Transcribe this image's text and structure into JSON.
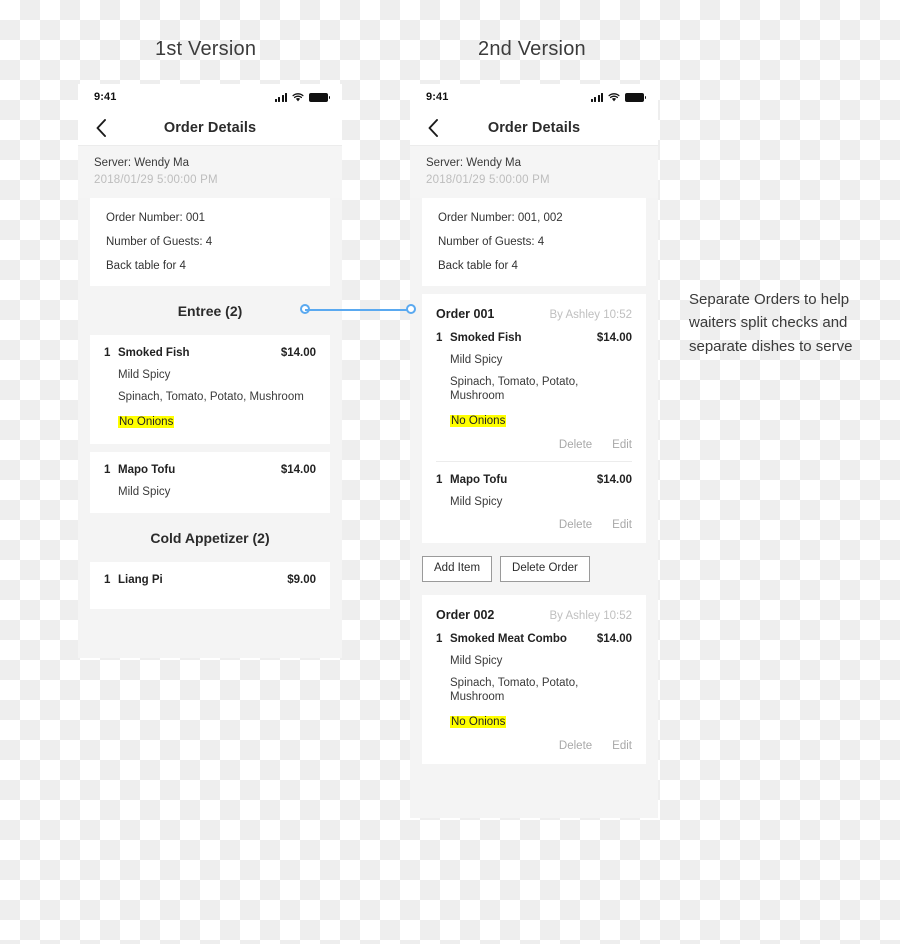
{
  "captions": {
    "version1": "1st Version",
    "version2": "2nd Version"
  },
  "annotation": {
    "text": "Separate Orders to help waiters split checks and separate dishes to serve"
  },
  "colors": {
    "accent": "#5aa9f0",
    "highlight": "#ffff00",
    "page_bg": "#f4f4f4",
    "card_bg": "#ffffff",
    "muted_text": "#bdbdbd"
  },
  "phone1": {
    "status": {
      "time": "9:41",
      "signal_icon": "signal-bars-icon",
      "wifi_icon": "wifi-icon",
      "battery_icon": "battery-full-icon"
    },
    "nav": {
      "back_icon": "chevron-left-icon",
      "title": "Order Details"
    },
    "server": {
      "name": "Server: Wendy Ma",
      "datetime": "2018/01/29  5:00:00 PM"
    },
    "info": {
      "order_number": "Order Number: 001",
      "guests": "Number of Guests: 4",
      "table": "Back table for 4"
    },
    "sections": [
      {
        "header": "Entree (2)",
        "items": [
          {
            "qty": "1",
            "name": "Smoked Fish",
            "price": "$14.00",
            "options": [
              "Mild Spicy",
              "Spinach, Tomato, Potato, Mushroom"
            ],
            "note": "No Onions"
          },
          {
            "qty": "1",
            "name": "Mapo Tofu",
            "price": "$14.00",
            "options": [
              "Mild Spicy"
            ],
            "note": ""
          }
        ]
      },
      {
        "header": "Cold Appetizer (2)",
        "items": [
          {
            "qty": "1",
            "name": "Liang Pi",
            "price": "$9.00",
            "options": [],
            "note": ""
          }
        ]
      }
    ]
  },
  "phone2": {
    "status": {
      "time": "9:41",
      "signal_icon": "signal-bars-icon",
      "wifi_icon": "wifi-icon",
      "battery_icon": "battery-full-icon"
    },
    "nav": {
      "back_icon": "chevron-left-icon",
      "title": "Order Details"
    },
    "server": {
      "name": "Server: Wendy Ma",
      "datetime": "2018/01/29  5:00:00 PM"
    },
    "info": {
      "order_number": "Order Number: 001, 002",
      "guests": "Number of Guests: 4",
      "table": "Back table for 4"
    },
    "orders": [
      {
        "title": "Order 001",
        "by": "By Ashley 10:52",
        "items": [
          {
            "qty": "1",
            "name": "Smoked Fish",
            "price": "$14.00",
            "options": [
              "Mild Spicy",
              "Spinach, Tomato, Potato, Mushroom"
            ],
            "note": "No Onions",
            "delete_label": "Delete",
            "edit_label": "Edit"
          },
          {
            "qty": "1",
            "name": "Mapo Tofu",
            "price": "$14.00",
            "options": [
              "Mild Spicy"
            ],
            "note": "",
            "delete_label": "Delete",
            "edit_label": "Edit"
          }
        ],
        "buttons": {
          "add_item": "Add Item",
          "delete_order": "Delete Order"
        }
      },
      {
        "title": "Order 002",
        "by": "By Ashley 10:52",
        "items": [
          {
            "qty": "1",
            "name": "Smoked Meat Combo",
            "price": "$14.00",
            "options": [
              "Mild Spicy",
              "Spinach, Tomato, Potato, Mushroom"
            ],
            "note": "No Onions",
            "delete_label": "Delete",
            "edit_label": "Edit"
          }
        ],
        "buttons": null
      }
    ]
  }
}
